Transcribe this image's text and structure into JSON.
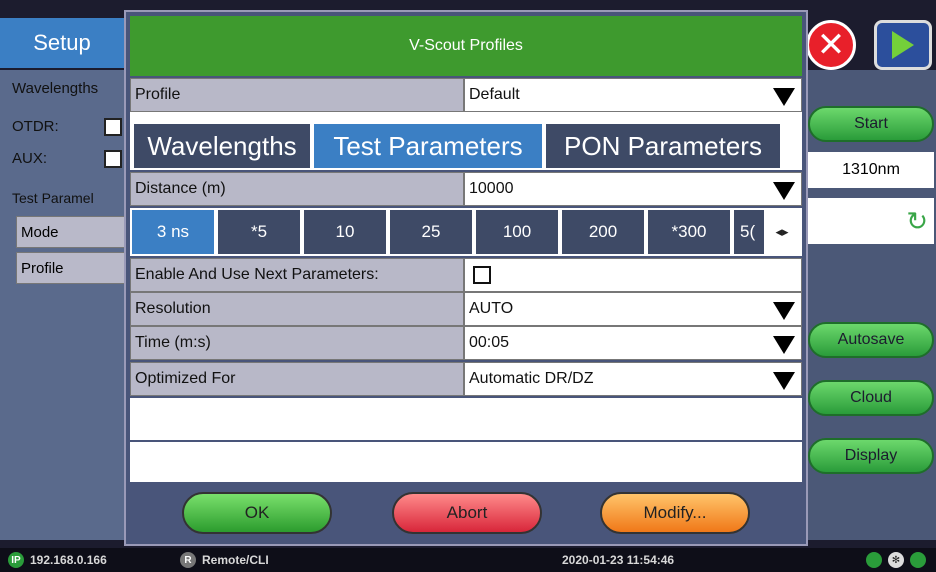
{
  "background": {
    "setup_title": "Setup",
    "left_panel": {
      "wavelengths_label": "Wavelengths",
      "otdr_label": "OTDR:",
      "aux_label": "AUX:",
      "test_params_label": "Test Paramel",
      "mode_label": "Mode",
      "profile_label": "Profile"
    },
    "right_panel": {
      "start_label": "Start",
      "wavelength_value": "1310nm",
      "autosave_label": "Autosave",
      "cloud_label": "Cloud",
      "display_label": "Display"
    }
  },
  "dialog": {
    "title": "V-Scout Profiles",
    "profile": {
      "label": "Profile",
      "value": "Default"
    },
    "tabs": [
      {
        "label": "Wavelengths",
        "active": false
      },
      {
        "label": "Test Parameters",
        "active": true
      },
      {
        "label": "PON Parameters",
        "active": false
      }
    ],
    "distance": {
      "label": "Distance (m)",
      "value": "10000"
    },
    "pulses": [
      "3 ns",
      "*5",
      "10",
      "25",
      "100",
      "200",
      "*300",
      "5("
    ],
    "active_pulse": "3 ns",
    "enable_next": {
      "label": "Enable And Use Next Parameters:",
      "checked": false
    },
    "resolution": {
      "label": "Resolution",
      "value": "AUTO"
    },
    "time": {
      "label": "Time (m:s)",
      "value": "00:05"
    },
    "optimized": {
      "label": "Optimized For",
      "value": "Automatic DR/DZ"
    },
    "buttons": {
      "ok": "OK",
      "abort": "Abort",
      "modify": "Modify..."
    }
  },
  "status_bar": {
    "ip_badge": "IP",
    "ip": "192.168.0.166",
    "remote_badge": "R",
    "remote": "Remote/CLI",
    "datetime": "2020-01-23 11:54:46"
  },
  "colors": {
    "title_green": "#3e9a2e",
    "tab_active": "#3b7fc4",
    "tab_inactive": "#3e4a66"
  }
}
